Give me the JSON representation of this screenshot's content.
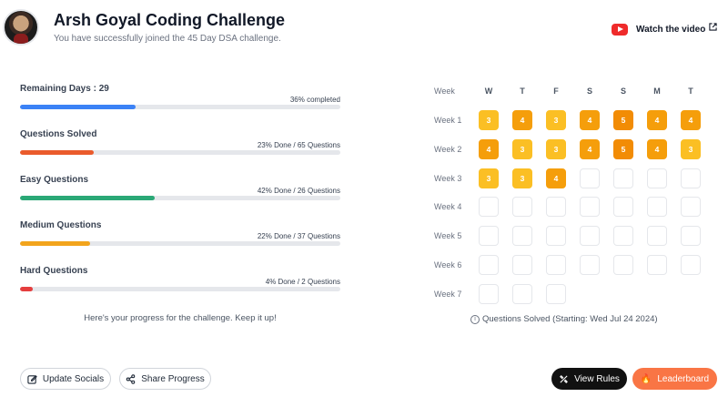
{
  "header": {
    "title": "Arsh Goyal Coding Challenge",
    "subtitle": "You have successfully joined the 45 Day DSA challenge.",
    "watch_label": "Watch the video"
  },
  "progress": {
    "remaining_days_label": "Remaining Days : 29",
    "remaining_days_status": "36% completed",
    "items": [
      {
        "label": "Questions Solved",
        "status": "23% Done / 65 Questions",
        "percent": 23,
        "color": "#ea5b2c"
      },
      {
        "label": "Easy Questions",
        "status": "42% Done / 26 Questions",
        "percent": 42,
        "color": "#2aa876"
      },
      {
        "label": "Medium Questions",
        "status": "22% Done / 37 Questions",
        "percent": 22,
        "color": "#f2a41c"
      },
      {
        "label": "Hard Questions",
        "status": "4% Done / 2 Questions",
        "percent": 4,
        "color": "#e53e3e"
      }
    ],
    "remaining_percent": 36,
    "remaining_color": "#3b82f6",
    "encouragement": "Here's your progress for the challenge. Keep it up!"
  },
  "calendar": {
    "week_header": "Week",
    "days": [
      "W",
      "T",
      "F",
      "S",
      "S",
      "M",
      "T"
    ],
    "weeks": [
      {
        "label": "Week 1",
        "cells": [
          3,
          4,
          3,
          4,
          5,
          4,
          4
        ]
      },
      {
        "label": "Week 2",
        "cells": [
          4,
          3,
          3,
          4,
          5,
          4,
          3
        ]
      },
      {
        "label": "Week 3",
        "cells": [
          3,
          3,
          4,
          null,
          null,
          null,
          null
        ]
      },
      {
        "label": "Week 4",
        "cells": [
          null,
          null,
          null,
          null,
          null,
          null,
          null
        ]
      },
      {
        "label": "Week 5",
        "cells": [
          null,
          null,
          null,
          null,
          null,
          null,
          null
        ]
      },
      {
        "label": "Week 6",
        "cells": [
          null,
          null,
          null,
          null,
          null,
          null,
          null
        ]
      },
      {
        "label": "Week 7",
        "cells": [
          null,
          null,
          null
        ]
      }
    ],
    "caption": "Questions Solved (Starting: Wed Jul 24 2024)"
  },
  "actions": {
    "update_socials": "Update Socials",
    "share_progress": "Share Progress",
    "view_rules": "View Rules",
    "leaderboard": "Leaderboard"
  }
}
